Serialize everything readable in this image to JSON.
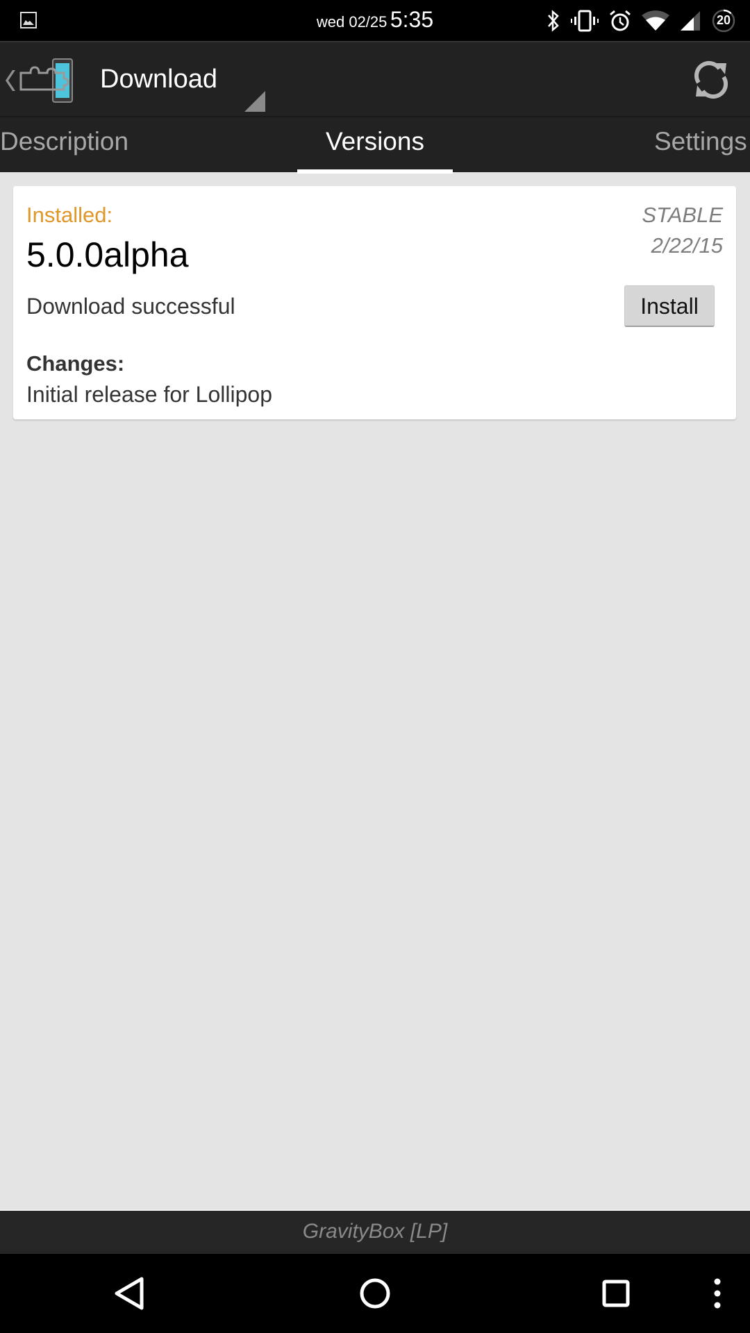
{
  "status_bar": {
    "date": "wed 02/25",
    "time": "5:35",
    "battery_level": "20",
    "icons": [
      "gallery-notification-icon",
      "bluetooth-icon",
      "vibrate-icon",
      "alarm-icon",
      "wifi-icon",
      "cell-signal-icon",
      "battery-icon"
    ]
  },
  "action_bar": {
    "title": "Download",
    "icons": [
      "up-caret-icon",
      "xposed-app-logo-icon",
      "spinner-dropdown-icon",
      "refresh-icon"
    ]
  },
  "tabs": [
    {
      "label": "Description",
      "active": false
    },
    {
      "label": "Versions",
      "active": true
    },
    {
      "label": "Settings",
      "active": false
    }
  ],
  "version_card": {
    "installed_label": "Installed:",
    "version_name": "5.0.0alpha",
    "branch": "STABLE",
    "date": "2/22/15",
    "download_status": "Download successful",
    "install_button": "Install",
    "changes_heading": "Changes:",
    "changes_text": "Initial release for Lollipop",
    "accent_color": "#e0972a"
  },
  "footer": {
    "module_name": "GravityBox [LP]"
  },
  "nav_bar": {
    "buttons": [
      "back",
      "home",
      "recents",
      "menu"
    ]
  }
}
